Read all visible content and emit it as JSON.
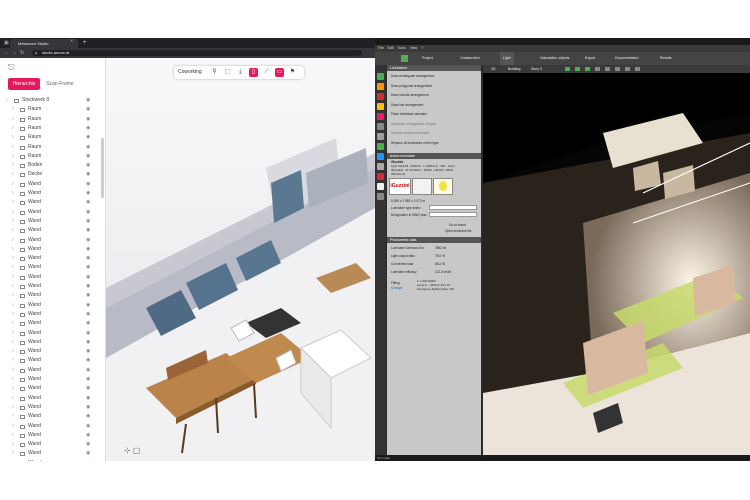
{
  "browser": {
    "tab_title": "Metaroom Studio",
    "url": "studio.amrax.at"
  },
  "sidebar": {
    "tabs": [
      "Hierarchie",
      "Scan-Frame"
    ],
    "tree": [
      {
        "label": "Stockwerk 0",
        "icon": "floor-icon"
      },
      {
        "label": "Raum",
        "icon": "room-icon"
      },
      {
        "label": "Raum",
        "icon": "room-icon"
      },
      {
        "label": "Raum",
        "icon": "room-icon"
      },
      {
        "label": "Raum",
        "icon": "room-icon"
      },
      {
        "label": "Raum",
        "icon": "room-icon"
      },
      {
        "label": "Raum",
        "icon": "room-icon"
      },
      {
        "label": "Boden",
        "icon": "floor-surface-icon"
      },
      {
        "label": "Decke",
        "icon": "ceiling-icon"
      },
      {
        "label": "Wand",
        "icon": "wall-icon"
      },
      {
        "label": "Wand",
        "icon": "wall-icon"
      },
      {
        "label": "Wand",
        "icon": "wall-icon"
      },
      {
        "label": "Wand",
        "icon": "wall-icon"
      },
      {
        "label": "Wand",
        "icon": "wall-icon"
      },
      {
        "label": "Wand",
        "icon": "wall-icon"
      },
      {
        "label": "Wand",
        "icon": "wall-icon"
      },
      {
        "label": "Wand",
        "icon": "wall-icon"
      },
      {
        "label": "Wand",
        "icon": "wall-icon"
      },
      {
        "label": "Wand",
        "icon": "wall-icon"
      },
      {
        "label": "Wand",
        "icon": "wall-icon"
      },
      {
        "label": "Wand",
        "icon": "wall-icon"
      },
      {
        "label": "Wand",
        "icon": "wall-icon"
      },
      {
        "label": "Wand",
        "icon": "wall-icon"
      },
      {
        "label": "Wand",
        "icon": "wall-icon"
      },
      {
        "label": "Wand",
        "icon": "wall-icon"
      },
      {
        "label": "Wand",
        "icon": "wall-icon"
      },
      {
        "label": "Wand",
        "icon": "wall-icon"
      },
      {
        "label": "Wand",
        "icon": "wall-icon"
      },
      {
        "label": "Wand",
        "icon": "wall-icon"
      },
      {
        "label": "Wand",
        "icon": "wall-icon"
      },
      {
        "label": "Wand",
        "icon": "wall-icon"
      },
      {
        "label": "Wand",
        "icon": "wall-icon"
      },
      {
        "label": "Wand",
        "icon": "wall-icon"
      },
      {
        "label": "Wand",
        "icon": "wall-icon"
      },
      {
        "label": "Wand",
        "icon": "wall-icon"
      },
      {
        "label": "Wand",
        "icon": "wall-icon"
      },
      {
        "label": "Wand",
        "icon": "wall-icon"
      },
      {
        "label": "Wand",
        "icon": "wall-icon"
      },
      {
        "label": "Wand",
        "icon": "wall-icon"
      },
      {
        "label": "Wand",
        "icon": "wall-icon"
      },
      {
        "label": "Wand",
        "icon": "wall-icon"
      }
    ]
  },
  "toolbar3d": {
    "label": "Coworking",
    "icons": [
      "measure-icon",
      "select-icon",
      "download-icon",
      "copy-icon",
      "graph-icon",
      "view-icon",
      "marker-icon"
    ],
    "active": [
      3,
      5
    ]
  },
  "app": {
    "menu": "File  Edit  Tools  View  ?",
    "ribbon": [
      "Project",
      "Construction",
      "Light",
      "Calculation objects",
      "Export",
      "Documentation",
      "Results"
    ],
    "active_ribbon": 2,
    "scene_tabs": [
      "3D",
      "Building",
      "Story 0"
    ],
    "panel": {
      "luminaires_header": "Luminaires",
      "actions": [
        "Draw rectangular arrangement",
        "Draw polygonal arrangement",
        "Draw circular arrangement",
        "Draw line arrangement",
        "Place individual luminaire",
        "Automatic arrangement of lights",
        "Replace selected luminaire",
        "Replace all luminaires of this type"
      ],
      "dim_actions": [
        5,
        6
      ],
      "active_header": "Active luminaire",
      "maker": "iGuzzini",
      "desc_lines": [
        "Light Shelf 18 - W01131 - L=1983 mm - Diff. - dimm.",
        "dimmable - 61.34 W/klm - 3000K - LED 84 - White",
        "W01131 (1)"
      ],
      "logo": "iGuzzini",
      "dims": "0.265 x 1.983 x 0.072 m",
      "fields": [
        "Luminaire type index",
        "Designation in DWG plan"
      ],
      "go_to_brand": "Go to brand",
      "open_list": "Open luminaire list",
      "photometry_header": "Photometric data",
      "props": [
        {
          "k": "Luminaire luminous flux",
          "v": "3962  lm"
        },
        {
          "k": "Light output ratio",
          "v": "78.0  %"
        },
        {
          "k": "Connected load",
          "v": "65.2  W"
        },
        {
          "k": "Luminaire efficacy",
          "v": "112.0  lm/W"
        }
      ],
      "fitting": "Fitting",
      "change": "Change",
      "fitting_vals": [
        "1 x LED 4000K",
        "Lamp lu...  3266 lm    65.2 W",
        "Emergency lighting factor  100"
      ]
    },
    "status": "Ctrl mode"
  },
  "colors": {
    "accent": "#e6195c",
    "app_green": "#4caf50"
  }
}
